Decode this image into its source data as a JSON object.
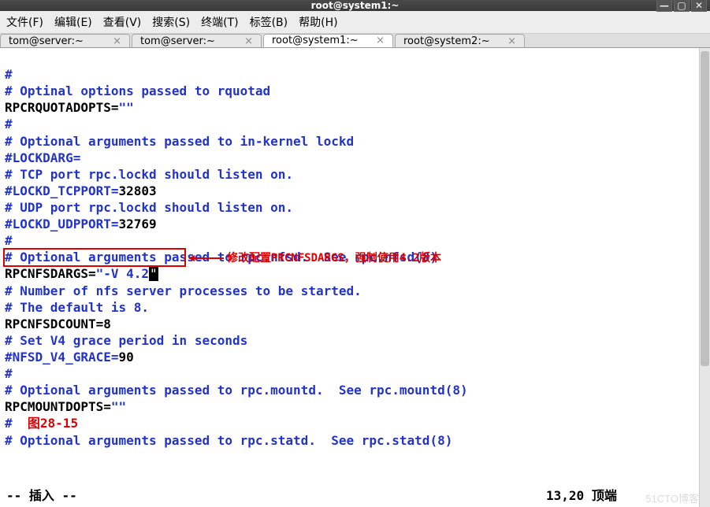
{
  "window": {
    "title": "root@system1:~"
  },
  "menu": {
    "file": "文件(F)",
    "edit": "编辑(E)",
    "view": "查看(V)",
    "search": "搜索(S)",
    "terminal": "终端(T)",
    "tabs": "标签(B)",
    "help": "帮助(H)"
  },
  "tabs": [
    {
      "label": "tom@server:~",
      "active": false
    },
    {
      "label": "tom@server:~",
      "active": false
    },
    {
      "label": "root@system1:~",
      "active": true
    },
    {
      "label": "root@system2:~",
      "active": false
    }
  ],
  "content": {
    "l1": "#",
    "l2": "# Optinal options passed to rquotad",
    "l3a": "RPCRQUOTADOPTS=",
    "l3b": "\"\"",
    "l4": "#",
    "l5": "# Optional arguments passed to in-kernel lockd",
    "l6": "#LOCKDARG=",
    "l7": "# TCP port rpc.lockd should listen on.",
    "l8a": "#LOCKD_TCPPORT=",
    "l8b": "32803",
    "l9": "# UDP port rpc.lockd should listen on.",
    "l10a": "#LOCKD_UDPPORT=",
    "l10b": "32769",
    "l11": "#",
    "l12": "# Optional arguments passed to rpc.nfsd.  See rpc.nfsd(8)",
    "l13a": "RPCNFSDARGS=",
    "l13b": "\"-V 4.2",
    "l13c": "\"",
    "l14": "# Number of nfs server processes to be started.",
    "l15": "# The default is 8.",
    "l16a": "RPCNFSDCOUNT=",
    "l16b": "8",
    "l17": "# Set V4 grace period in seconds",
    "l18a": "#NFSD_V4_GRACE=",
    "l18b": "90",
    "l19": "#",
    "l20": "# Optional arguments passed to rpc.mountd.  See rpc.mountd(8)",
    "l21a": "RPCMOUNTDOPTS=",
    "l21b": "\"\"",
    "l22": "#",
    "l23": "# Optional arguments passed to rpc.statd.  See rpc.statd(8)"
  },
  "annotation": {
    "text": "修改配置PRCNFSDARGS，强制使用4.2版本",
    "figlabel": "图28-15"
  },
  "status": {
    "mode": "-- 插入 --",
    "position": "13,20",
    "scroll": "顶端"
  },
  "watermark": "51CTO博客"
}
